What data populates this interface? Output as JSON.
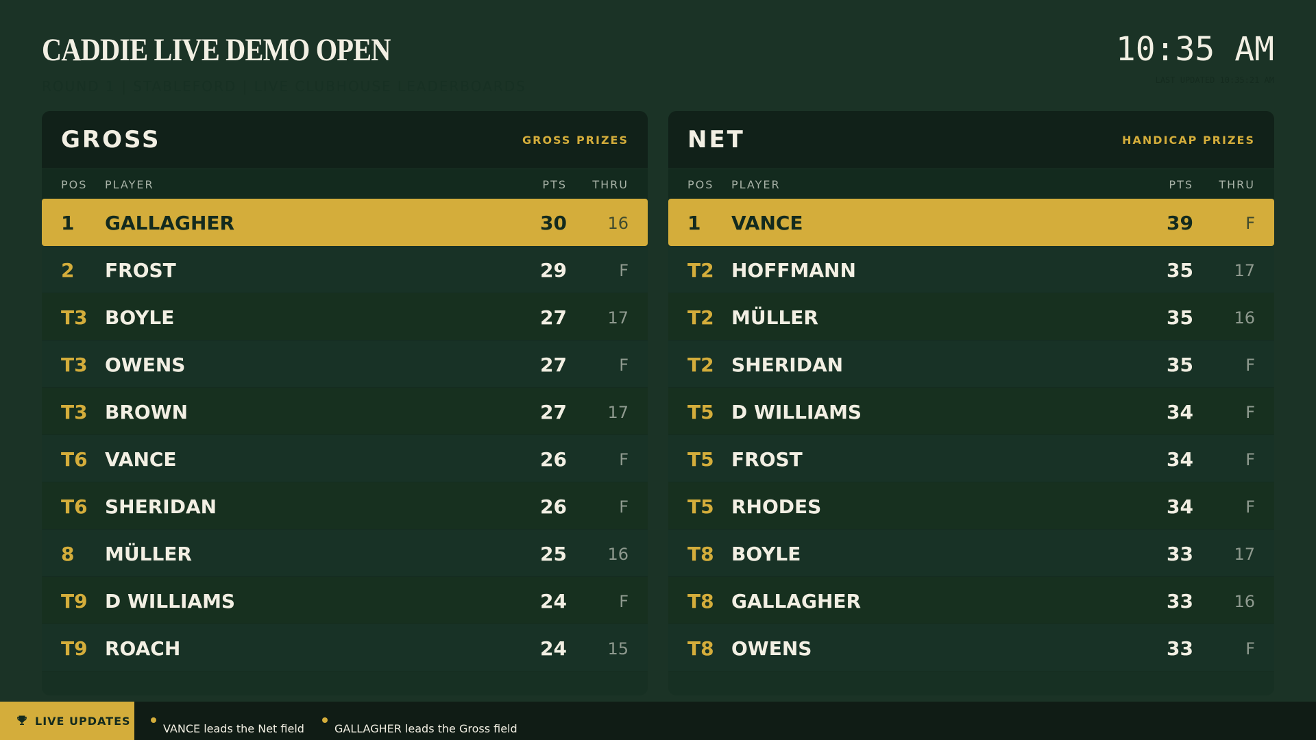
{
  "header": {
    "title": "CADDIE LIVE DEMO OPEN",
    "subtitle": "ROUND 1 | STABLEFORD | LIVE CLUBHOUSE LEADERBOARDS",
    "clock": "10:35 AM",
    "last_updated": "LAST UPDATED 10:35:21 AM"
  },
  "columns": {
    "pos": "POS",
    "player": "PLAYER",
    "pts": "PTS",
    "thru": "THRU"
  },
  "gross": {
    "title": "GROSS",
    "prize": "GROSS PRIZES",
    "rows": [
      {
        "pos": "1",
        "player": "GALLAGHER",
        "pts": "30",
        "thru": "16"
      },
      {
        "pos": "2",
        "player": "FROST",
        "pts": "29",
        "thru": "F"
      },
      {
        "pos": "T3",
        "player": "BOYLE",
        "pts": "27",
        "thru": "17"
      },
      {
        "pos": "T3",
        "player": "OWENS",
        "pts": "27",
        "thru": "F"
      },
      {
        "pos": "T3",
        "player": "BROWN",
        "pts": "27",
        "thru": "17"
      },
      {
        "pos": "T6",
        "player": "VANCE",
        "pts": "26",
        "thru": "F"
      },
      {
        "pos": "T6",
        "player": "SHERIDAN",
        "pts": "26",
        "thru": "F"
      },
      {
        "pos": "8",
        "player": "MÜLLER",
        "pts": "25",
        "thru": "16"
      },
      {
        "pos": "T9",
        "player": "D WILLIAMS",
        "pts": "24",
        "thru": "F"
      },
      {
        "pos": "T9",
        "player": "ROACH",
        "pts": "24",
        "thru": "15"
      }
    ]
  },
  "net": {
    "title": "NET",
    "prize": "HANDICAP PRIZES",
    "rows": [
      {
        "pos": "1",
        "player": "VANCE",
        "pts": "39",
        "thru": "F"
      },
      {
        "pos": "T2",
        "player": "HOFFMANN",
        "pts": "35",
        "thru": "17"
      },
      {
        "pos": "T2",
        "player": "MÜLLER",
        "pts": "35",
        "thru": "16"
      },
      {
        "pos": "T2",
        "player": "SHERIDAN",
        "pts": "35",
        "thru": "F"
      },
      {
        "pos": "T5",
        "player": "D WILLIAMS",
        "pts": "34",
        "thru": "F"
      },
      {
        "pos": "T5",
        "player": "FROST",
        "pts": "34",
        "thru": "F"
      },
      {
        "pos": "T5",
        "player": "RHODES",
        "pts": "34",
        "thru": "F"
      },
      {
        "pos": "T8",
        "player": "BOYLE",
        "pts": "33",
        "thru": "17"
      },
      {
        "pos": "T8",
        "player": "GALLAGHER",
        "pts": "33",
        "thru": "16"
      },
      {
        "pos": "T8",
        "player": "OWENS",
        "pts": "33",
        "thru": "F"
      }
    ]
  },
  "ticker": {
    "label": "LIVE UPDATES",
    "icon": "trophy-icon",
    "items": [
      "VANCE leads the Net field",
      "GALLAGHER leads the Gross field"
    ]
  },
  "colors": {
    "background": "#1b3326",
    "accent": "#d4ad3b",
    "text": "#f2efe3"
  }
}
